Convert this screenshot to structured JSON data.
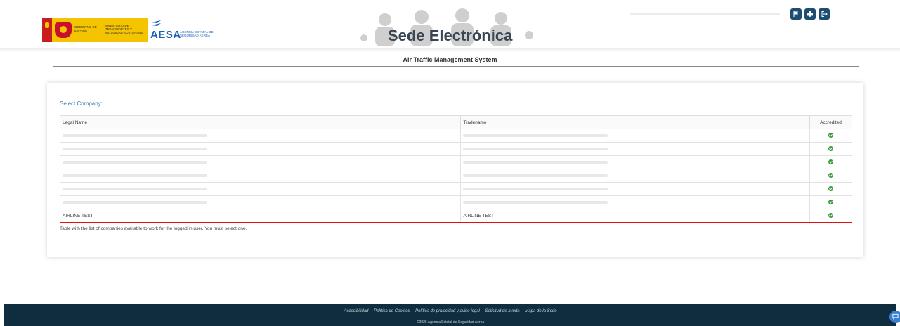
{
  "header": {
    "gov_text": "GOBIERNO DE ESPAÑA",
    "ministry_text": "MINISTERIO DE TRANSPORTES Y MOVILIDAD SOSTENIBLE",
    "aesa_name": "AESA",
    "aesa_sub": "AGENCIA ESTATAL DE SEGURIDAD AÉREA",
    "sede_title": "Sede Electrónica",
    "buttons": [
      {
        "icon": "flag-icon"
      },
      {
        "icon": "print-icon"
      },
      {
        "icon": "logout-icon"
      }
    ],
    "accent_color": "#1d4e72"
  },
  "main": {
    "title": "Air Traffic Management System",
    "select_label": "Select Company:",
    "columns": [
      "Legal Name",
      "Tradename",
      "Accredited"
    ],
    "rows": [
      {
        "legal_name": "",
        "tradename": "",
        "accredited": true
      },
      {
        "legal_name": "",
        "tradename": "",
        "accredited": true
      },
      {
        "legal_name": "",
        "tradename": "",
        "accredited": true
      },
      {
        "legal_name": "",
        "tradename": "",
        "accredited": true
      },
      {
        "legal_name": "",
        "tradename": "",
        "accredited": true
      },
      {
        "legal_name": "",
        "tradename": "",
        "accredited": true
      },
      {
        "legal_name": "AIRLINE TEST",
        "tradename": "AIRLINE TEST",
        "accredited": true,
        "highlighted": true
      }
    ],
    "caption": "Table with the list of companies available to work for the logged in user. You must select one."
  },
  "footer": {
    "links": [
      "Accesibilidad",
      "Política de Cookies",
      "Política de privacidad y aviso legal",
      "Solicitud de ayuda",
      "Mapa de la Sede"
    ],
    "copyright": "©2026 Agencia Estatal de Seguridad Aérea",
    "background": "#0f2d3e"
  }
}
